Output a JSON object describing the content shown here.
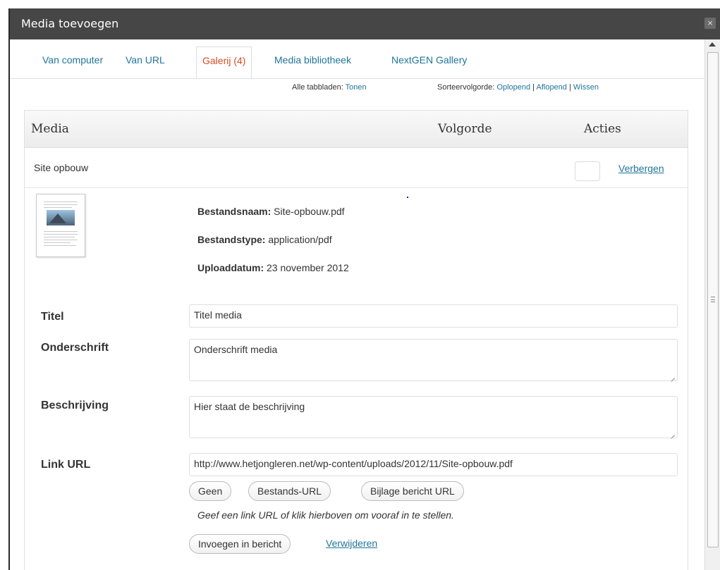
{
  "dialog": {
    "title": "Media toevoegen",
    "close_glyph": "×"
  },
  "tabs": [
    {
      "label": "Van computer",
      "active": false
    },
    {
      "label": "Van URL",
      "active": false
    },
    {
      "label": "Galerij (4)",
      "active": true
    },
    {
      "label": "Media bibliotheek",
      "active": false
    },
    {
      "label": "NextGEN Gallery",
      "active": false
    }
  ],
  "toolbar": {
    "all_tabs_label": "Alle tabbladen:",
    "show_link": "Tonen",
    "sort_label": "Sorteervolgorde:",
    "ascending": "Oplopend",
    "separator": "|",
    "descending": "Aflopend",
    "clear": "Wissen"
  },
  "table": {
    "headers": [
      "Media",
      "Volgorde",
      "Acties"
    ]
  },
  "item": {
    "name": "Site opbouw",
    "order_value": "",
    "hide_link": "Verbergen"
  },
  "meta": {
    "filename_label": "Bestandsnaam:",
    "filename": "Site-opbouw.pdf",
    "filetype_label": "Bestandstype:",
    "filetype": "application/pdf",
    "upload_label": "Uploaddatum:",
    "upload_date": "23 november 2012"
  },
  "fields": {
    "title_label": "Titel",
    "title_value": "Titel media",
    "caption_label": "Onderschrift",
    "caption_value": "Onderschrift media",
    "description_label": "Beschrijving",
    "description_value": "Hier staat de beschrijving",
    "link_label": "Link URL",
    "link_value": "http://www.hetjongleren.net/wp-content/uploads/2012/11/Site-opbouw.pdf"
  },
  "link_buttons": [
    "Geen",
    "Bestands-URL",
    "Bijlage bericht URL"
  ],
  "help_text": "Geef een link URL of klik hierboven om vooraf in te stellen.",
  "actions": {
    "insert_button": "Invoegen in bericht",
    "delete_link": "Verwijderen"
  },
  "icons": {
    "close": "close-icon",
    "scroll_up": "arrow-up-icon",
    "thumbnail": "pdf-document-thumbnail"
  },
  "colors": {
    "link": "#21759b",
    "active_tab": "#d54e21",
    "titlebar": "#464646"
  }
}
